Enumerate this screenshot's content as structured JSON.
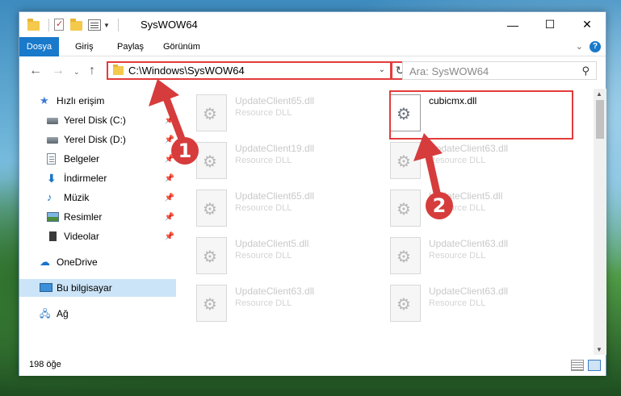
{
  "window": {
    "title": "SysWOW64",
    "minimize": "—",
    "maximize": "☐",
    "close": "✕"
  },
  "ribbon": {
    "tabs": [
      "Dosya",
      "Giriş",
      "Paylaş",
      "Görünüm"
    ],
    "help": "?"
  },
  "nav": {
    "address": "C:\\Windows\\SysWOW64",
    "search_placeholder": "Ara: SysWOW64"
  },
  "sidebar": {
    "items": [
      {
        "label": "Hızlı erişim",
        "icon": "star-icon"
      },
      {
        "label": "Yerel Disk (C:)",
        "icon": "disk-icon",
        "pinned": true
      },
      {
        "label": "Yerel Disk (D:)",
        "icon": "disk-icon",
        "pinned": true
      },
      {
        "label": "Belgeler",
        "icon": "documents-icon",
        "pinned": true
      },
      {
        "label": "İndirmeler",
        "icon": "downloads-icon",
        "pinned": true
      },
      {
        "label": "Müzik",
        "icon": "music-icon",
        "pinned": true
      },
      {
        "label": "Resimler",
        "icon": "pictures-icon",
        "pinned": true
      },
      {
        "label": "Videolar",
        "icon": "videos-icon",
        "pinned": true
      },
      {
        "label": "OneDrive",
        "icon": "cloud-icon"
      },
      {
        "label": "Bu bilgisayar",
        "icon": "computer-icon",
        "selected": true
      },
      {
        "label": "Ağ",
        "icon": "network-icon"
      }
    ]
  },
  "files": [
    {
      "name": "UpdateClient65.dll",
      "type": "Resource DLL"
    },
    {
      "name": "cubicmx.dll",
      "type": "",
      "highlighted": true
    },
    {
      "name": "UpdateClient19.dll",
      "type": "Resource DLL"
    },
    {
      "name": "UpdateClient63.dll",
      "type": "Resource DLL"
    },
    {
      "name": "UpdateClient65.dll",
      "type": "Resource DLL"
    },
    {
      "name": "UpdateClient5.dll",
      "type": "Resource DLL"
    },
    {
      "name": "UpdateClient5.dll",
      "type": "Resource DLL"
    },
    {
      "name": "UpdateClient63.dll",
      "type": "Resource DLL"
    },
    {
      "name": "UpdateClient63.dll",
      "type": "Resource DLL"
    },
    {
      "name": "UpdateClient63.dll",
      "type": "Resource DLL"
    }
  ],
  "status": {
    "item_count": "198 öğe"
  },
  "callouts": [
    "1",
    "2"
  ],
  "colors": {
    "accent": "#1979ca",
    "highlight_red": "#e33b3b",
    "callout_red": "#d63c3c",
    "selected_bg": "#cce4f7"
  }
}
